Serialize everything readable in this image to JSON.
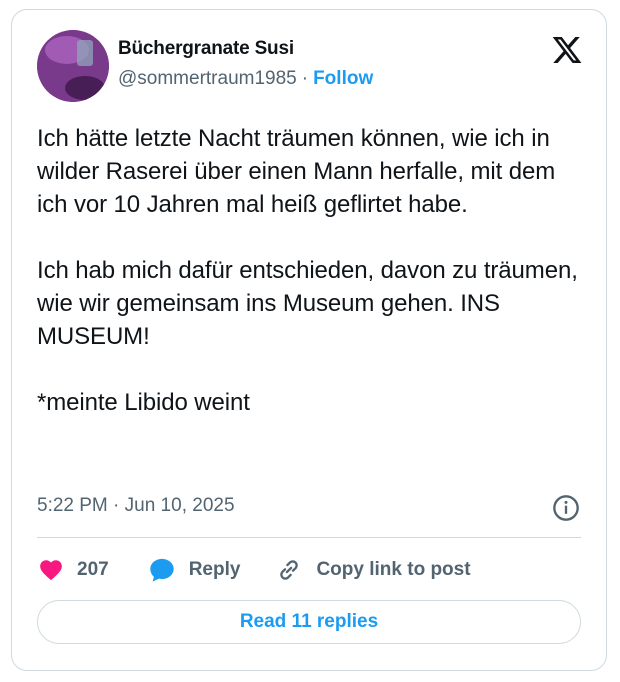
{
  "author": {
    "display_name": "Büchergranate Susi",
    "handle": "@sommertraum1985",
    "separator": "·",
    "follow_label": "Follow"
  },
  "tweet": {
    "text": "Ich hätte letzte Nacht träumen können, wie ich in wilder Raserei über einen Mann herfalle, mit dem ich vor 10 Jahren mal heiß geflirtet habe.\n\nIch hab mich dafür entschieden, davon zu träumen, wie wir gemeinsam ins Museum gehen. INS MUSEUM!\n\n*meinte Libido weint",
    "timestamp": "5:22 PM · Jun 10, 2025"
  },
  "actions": {
    "like_count": "207",
    "reply_label": "Reply",
    "copy_link_label": "Copy link to post"
  },
  "read_replies_label": "Read 11 replies",
  "icons": {
    "logo": "x-logo-icon",
    "info": "info-icon",
    "like": "heart-icon",
    "reply": "speech-bubble-icon",
    "copy": "link-icon"
  },
  "colors": {
    "accent": "#1d9bf0",
    "like": "#f91880",
    "secondary_text": "#536471",
    "border": "#cfd9de"
  }
}
